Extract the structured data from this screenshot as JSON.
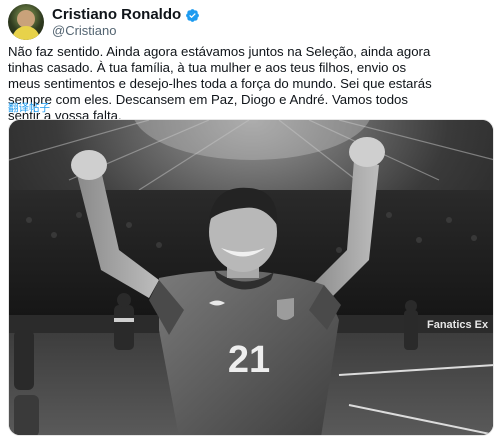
{
  "author": {
    "display_name": "Cristiano Ronaldo",
    "handle": "@Cristiano",
    "verified_icon": "verified-badge-icon",
    "verified_color": "#1d9bf0"
  },
  "tweet": {
    "text": "Não faz sentido. Ainda agora estávamos juntos na Seleção, ainda agora\ntinhas casado. À tua família, à tua mulher e aos teus filhos, envio os\nmeus sentimentos e desejo-lhes toda a força do mundo. Sei que estarás\nsempre com eles. Descansem em Paz, Diogo e André. Vamos todos\nsentir a vossa falta.",
    "translate_label": "翻译帖子"
  },
  "media": {
    "jersey_number": "21",
    "sponsor_text": "Fanatics Ex",
    "link_color": "#1d9bf0"
  }
}
